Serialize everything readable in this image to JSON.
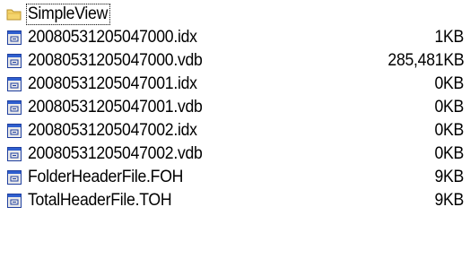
{
  "folder": {
    "name": "SimpleView",
    "icon": "folder-icon"
  },
  "files": [
    {
      "name": "20080531205047000.idx",
      "size": "1KB",
      "icon": "file-icon"
    },
    {
      "name": "20080531205047000.vdb",
      "size": "285,481KB",
      "icon": "file-icon"
    },
    {
      "name": "20080531205047001.idx",
      "size": "0KB",
      "icon": "file-icon"
    },
    {
      "name": "20080531205047001.vdb",
      "size": "0KB",
      "icon": "file-icon"
    },
    {
      "name": "20080531205047002.idx",
      "size": "0KB",
      "icon": "file-icon"
    },
    {
      "name": "20080531205047002.vdb",
      "size": "0KB",
      "icon": "file-icon"
    },
    {
      "name": "FolderHeaderFile.FOH",
      "size": "9KB",
      "icon": "file-icon"
    },
    {
      "name": "TotalHeaderFile.TOH",
      "size": "9KB",
      "icon": "file-icon"
    }
  ],
  "colors": {
    "folder_fill": "#f4d46c",
    "folder_edge": "#b8902c",
    "file_frame": "#1f3f9f",
    "file_title": "#2f5fcf",
    "file_body": "#eaeaea"
  }
}
